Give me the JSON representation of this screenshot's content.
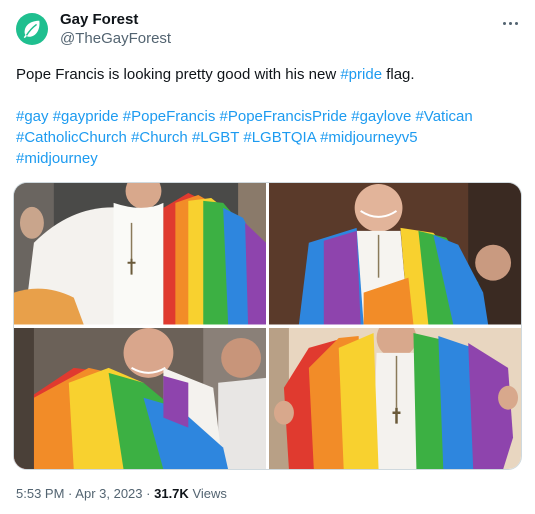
{
  "author": {
    "name": "Gay Forest",
    "handle": "@TheGayForest",
    "avatar_icon": "leaf-icon",
    "avatar_color": "#1fbf8f"
  },
  "tweet": {
    "text_before": "Pope Francis is looking pretty good with his new ",
    "text_link": "#pride",
    "text_after": " flag.",
    "hashtags": [
      "#gay",
      "#gaypride",
      "#PopeFrancis",
      "#PopeFrancisPride",
      "#gaylove",
      "#Vatican",
      "#CatholicChurch",
      "#Church",
      "#LGBT",
      "#LGBTQIA",
      "#midjourneyv5",
      "#midjourney"
    ]
  },
  "meta": {
    "time": "5:53 PM",
    "separator": "·",
    "date": "Apr 3, 2023",
    "views_count": "31.7K",
    "views_label": "Views"
  },
  "colors": {
    "link": "#1d9bf0",
    "secondary_text": "#536471",
    "primary_text": "#0f1419"
  },
  "more_icon": "more-horizontal-icon"
}
